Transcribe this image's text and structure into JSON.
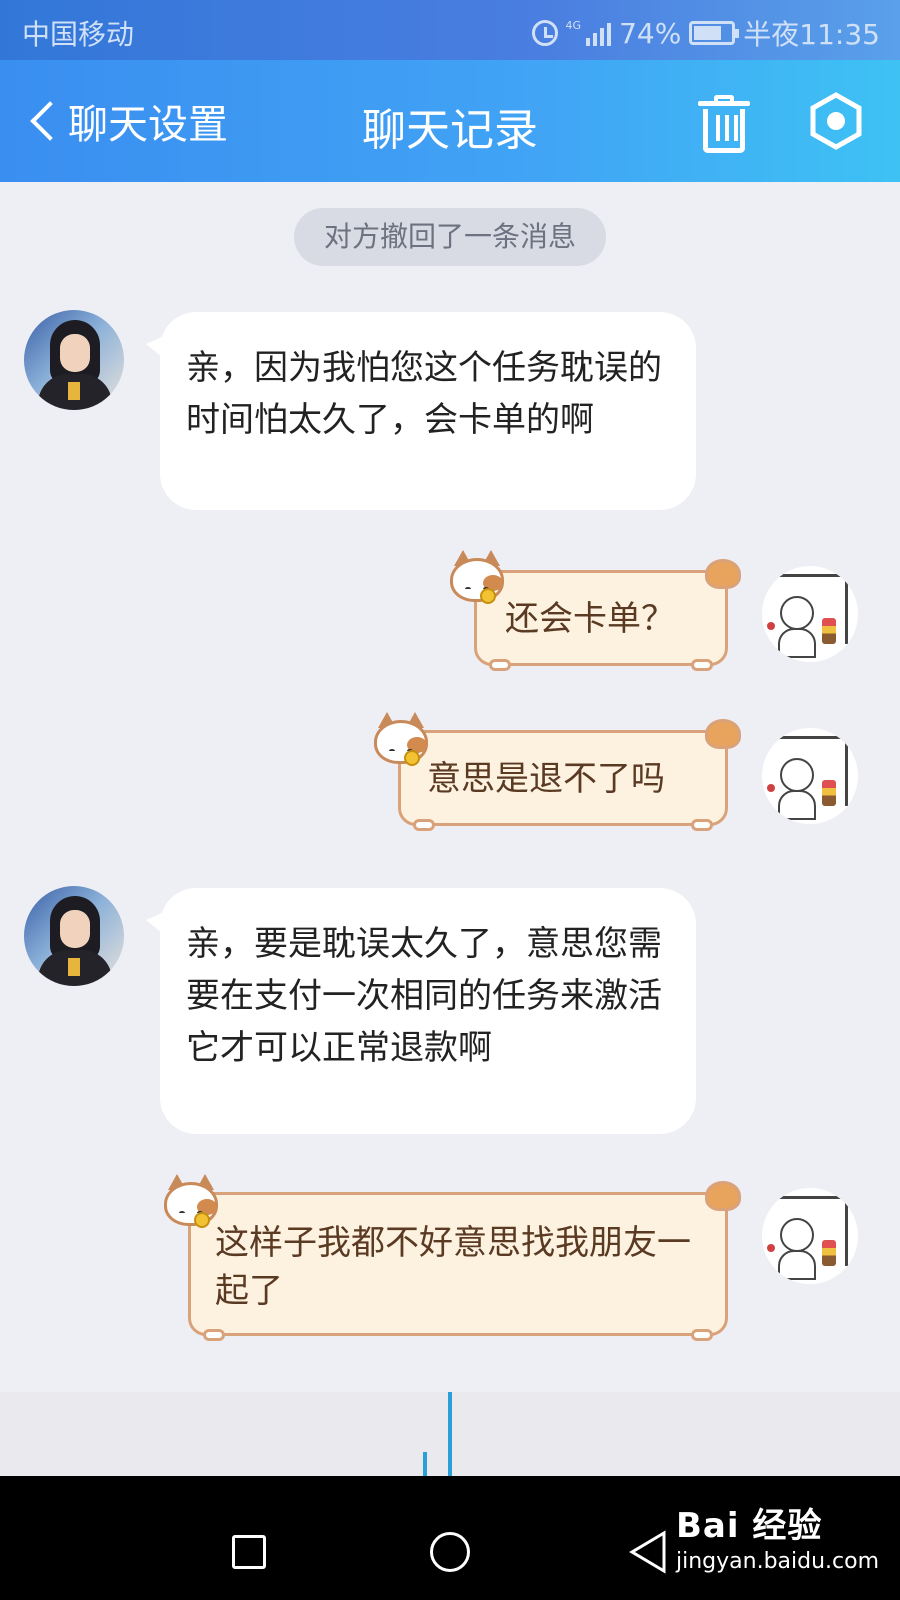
{
  "status_bar": {
    "carrier": "中国移动",
    "network": "4G",
    "battery": "74%",
    "battery_level": 0.74,
    "time": "半夜11:35"
  },
  "nav": {
    "back_label": "聊天设置",
    "title": "聊天记录"
  },
  "system_notice": "对方撤回了一条消息",
  "messages": [
    {
      "side": "left",
      "text": "亲，因为我怕您这个任务耽误的时间怕太久了，会卡单的啊"
    },
    {
      "side": "right",
      "text": "还会卡单？"
    },
    {
      "side": "right",
      "text": "意思是退不了吗"
    },
    {
      "side": "left",
      "text": "亲，要是耽误太久了，意思您需要在支付一次相同的任务来激活它才可以正常退款啊"
    },
    {
      "side": "right",
      "text": "这样子我都不好意思找我朋友一起了"
    }
  ],
  "watermark": {
    "brand": "Bai 经验",
    "url": "jingyan.baidu.com"
  },
  "colors": {
    "nav_bar": "#41a4f5",
    "chat_background": "#eeeef5",
    "left_bubble": "#ffffff",
    "right_bubble": "#fdf2e0",
    "right_bubble_border": "#d9a27a"
  }
}
